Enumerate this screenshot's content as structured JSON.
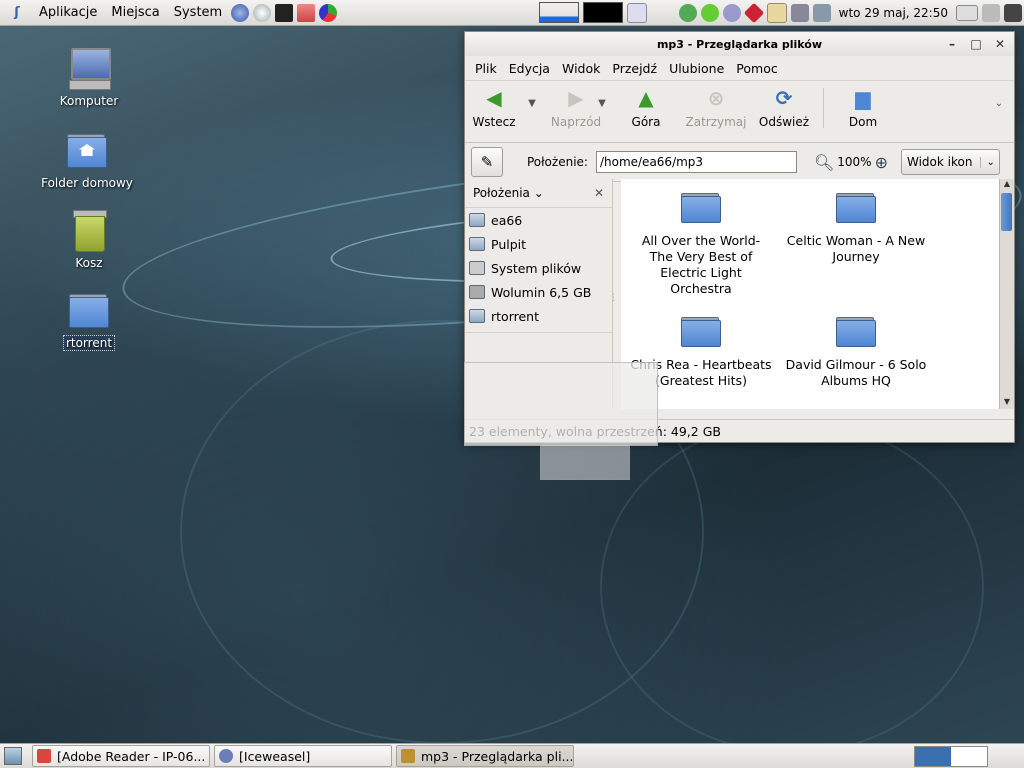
{
  "top_panel": {
    "menus": [
      "Aplikacje",
      "Miejsca",
      "System"
    ],
    "clock": "wto 29 maj, 22:50"
  },
  "desktop": {
    "icons": [
      {
        "label": "Komputer"
      },
      {
        "label": "Folder domowy"
      },
      {
        "label": "Kosz"
      },
      {
        "label": "rtorrent"
      }
    ]
  },
  "window": {
    "title": "mp3 - Przeglądarka plików",
    "menu": [
      "Plik",
      "Edycja",
      "Widok",
      "Przejdź",
      "Ulubione",
      "Pomoc"
    ],
    "toolbar": {
      "back": "Wstecz",
      "forward": "Naprzód",
      "up": "Góra",
      "stop": "Zatrzymaj",
      "reload": "Odśwież",
      "home": "Dom"
    },
    "location": {
      "label": "Położenie:",
      "value": "/home/ea66/mp3",
      "zoom": "100%",
      "view": "Widok ikon"
    },
    "sidepane": {
      "title": "Położenia",
      "places": [
        "ea66",
        "Pulpit",
        "System plików",
        "Wolumin 6,5 GB",
        "rtorrent"
      ]
    },
    "files": [
      {
        "name": "All Over the World- The Very Best of Electric Light Orchestra"
      },
      {
        "name": "Celtic Woman - A New Journey"
      },
      {
        "name": "Chris Rea - Heartbeats (Greatest Hits)"
      },
      {
        "name": "David Gilmour - 6 Solo Albums HQ"
      },
      {
        "name": ""
      },
      {
        "name": ""
      }
    ],
    "status": "23 elementy, wolna przestrzeń: 49,2 GB"
  },
  "taskbar": {
    "tasks": [
      {
        "label": "[Adobe Reader - IP-06...",
        "color": "#d8473c"
      },
      {
        "label": "[Iceweasel]",
        "color": "#6a7fb8"
      },
      {
        "label": "mp3 - Przeglądarka pli...",
        "color": "#c09030"
      }
    ]
  },
  "colors": {
    "folder_blue": "#4f86d4",
    "accent": "#3a6fb0"
  }
}
